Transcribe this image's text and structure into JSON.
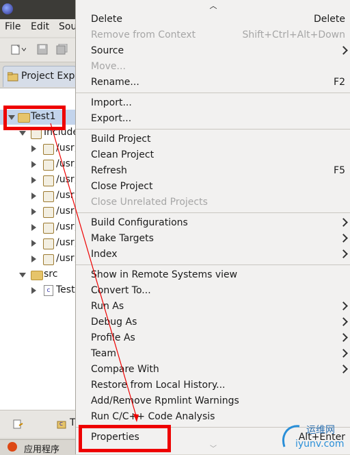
{
  "menubar": {
    "items": [
      "File",
      "Edit",
      "Sou"
    ]
  },
  "explorer": {
    "tab_label": "Project Expl",
    "project": "Test1",
    "includes": "Include",
    "include_paths": [
      "/usr,",
      "/usr,",
      "/usr,",
      "/usr,",
      "/usr,",
      "/usr,",
      "/usr,",
      "/usr,"
    ],
    "src_folder": "src",
    "src_file": "Test"
  },
  "bottom": {
    "tab_label": "T"
  },
  "taskbar": {
    "label": "应用程序"
  },
  "context_menu": {
    "items": [
      {
        "label": "Delete",
        "accel": "Delete",
        "enabled": true,
        "submenu": false
      },
      {
        "label": "Remove from Context",
        "accel": "Shift+Ctrl+Alt+Down",
        "enabled": false,
        "submenu": false
      },
      {
        "label": "Source",
        "accel": "",
        "enabled": true,
        "submenu": true
      },
      {
        "label": "Move...",
        "accel": "",
        "enabled": false,
        "submenu": false
      },
      {
        "label": "Rename...",
        "accel": "F2",
        "enabled": true,
        "submenu": false
      },
      {
        "label": "Import...",
        "accel": "",
        "enabled": true,
        "submenu": false
      },
      {
        "label": "Export...",
        "accel": "",
        "enabled": true,
        "submenu": false
      },
      {
        "label": "Build Project",
        "accel": "",
        "enabled": true,
        "submenu": false
      },
      {
        "label": "Clean Project",
        "accel": "",
        "enabled": true,
        "submenu": false
      },
      {
        "label": "Refresh",
        "accel": "F5",
        "enabled": true,
        "submenu": false
      },
      {
        "label": "Close Project",
        "accel": "",
        "enabled": true,
        "submenu": false
      },
      {
        "label": "Close Unrelated Projects",
        "accel": "",
        "enabled": false,
        "submenu": false
      },
      {
        "label": "Build Configurations",
        "accel": "",
        "enabled": true,
        "submenu": true
      },
      {
        "label": "Make Targets",
        "accel": "",
        "enabled": true,
        "submenu": true
      },
      {
        "label": "Index",
        "accel": "",
        "enabled": true,
        "submenu": true
      },
      {
        "label": "Show in Remote Systems view",
        "accel": "",
        "enabled": true,
        "submenu": false
      },
      {
        "label": "Convert To...",
        "accel": "",
        "enabled": true,
        "submenu": false
      },
      {
        "label": "Run As",
        "accel": "",
        "enabled": true,
        "submenu": true
      },
      {
        "label": "Debug As",
        "accel": "",
        "enabled": true,
        "submenu": true
      },
      {
        "label": "Profile As",
        "accel": "",
        "enabled": true,
        "submenu": true
      },
      {
        "label": "Team",
        "accel": "",
        "enabled": true,
        "submenu": true
      },
      {
        "label": "Compare With",
        "accel": "",
        "enabled": true,
        "submenu": true
      },
      {
        "label": "Restore from Local History...",
        "accel": "",
        "enabled": true,
        "submenu": false
      },
      {
        "label": "Add/Remove Rpmlint Warnings",
        "accel": "",
        "enabled": true,
        "submenu": false
      },
      {
        "label": "Run C/C++ Code Analysis",
        "accel": "",
        "enabled": true,
        "submenu": false
      },
      {
        "label": "Properties",
        "accel": "Alt+Enter",
        "enabled": true,
        "submenu": false
      }
    ]
  },
  "watermark": {
    "line1": "运维网",
    "line2": "iyunv.com"
  },
  "colors": {
    "annotation": "#ee0000",
    "menu_bg": "#f2f1f0",
    "disabled": "#a6a6a6"
  }
}
